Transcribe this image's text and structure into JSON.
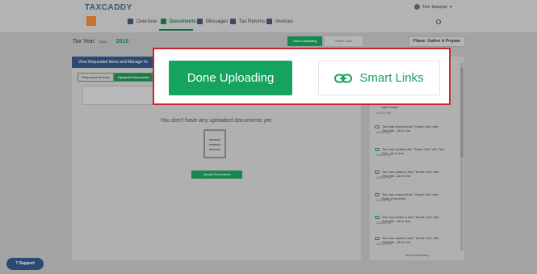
{
  "app": {
    "logo": "TAXCADDY"
  },
  "user": {
    "name": "Tom Taxpayer"
  },
  "nav": [
    {
      "label": "Overview",
      "active": false
    },
    {
      "label": "Documents",
      "active": true
    },
    {
      "label": "Messages",
      "active": false
    },
    {
      "label": "Tax Returns",
      "active": false
    },
    {
      "label": "Invoices",
      "active": false
    }
  ],
  "header": {
    "tax_year_label": "Tax Year",
    "tax_year_prev": "2018",
    "tax_year_value": "2019",
    "phase": "Phase: Gather & Prepare",
    "mini_done": "Done Uploading",
    "mini_smart": "Smart Links"
  },
  "panel": {
    "title": "View Requested Items and Manage Yo",
    "tabs": [
      "Requested Items(s)",
      "Uploaded Documents"
    ],
    "empty_text": "You don't have any uploaded documents yet.",
    "upload_button": "Upload Documents"
  },
  "history": {
    "items": [
      {
        "text": "with Chase.",
        "time": "4:20:10 PM"
      },
      {
        "text": "Tom has removed the \"Smart Link\" with Test Site - All in one.",
        "time": "4:20:10 PM"
      },
      {
        "text": "Tom has updated the \"Smart Link\" with Test Site - All in one.",
        "time": "4:20:10 PM"
      },
      {
        "text": "Tom has added a new \"Smart Link\" with Test Site - All in one.",
        "time": "4:20:10 PM"
      },
      {
        "text": "Tom has removed the \"Smart Link\" with Bank of America.",
        "time": "4:20:10 PM"
      },
      {
        "text": "Tom has added a new \"Smart Link\" with Test Site - All in one.",
        "time": "4:20:10 PM"
      },
      {
        "text": "Tom has added a new \"Smart Link\" with Test Site - All in one.",
        "time": "4:20:10 PM"
      }
    ],
    "view_full": "View Full History"
  },
  "support": {
    "label": "Support"
  },
  "callout": {
    "done_label": "Done Uploading",
    "smart_label": "Smart Links"
  },
  "colors": {
    "brand_green": "#15a35f",
    "highlight_border": "#c8262c",
    "navy": "#2c4972"
  }
}
